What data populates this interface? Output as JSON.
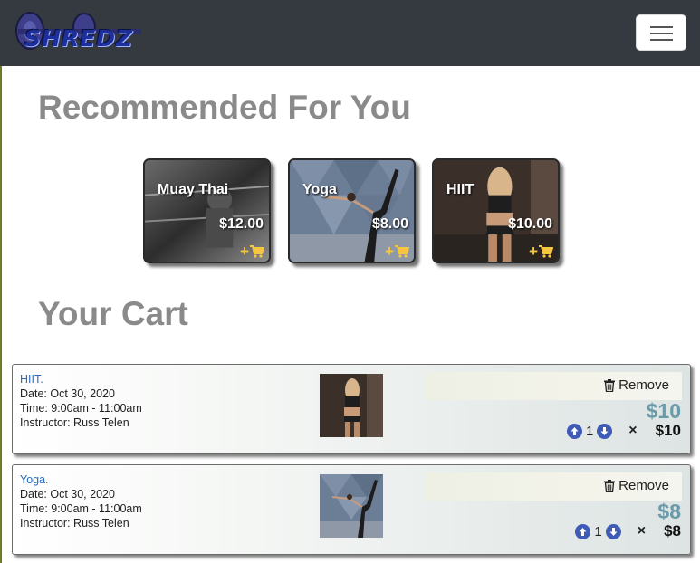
{
  "brand": {
    "logo_text": "SHREDZ"
  },
  "sections": {
    "recommended_title": "Recommended For You",
    "cart_title": "Your Cart"
  },
  "recommended": [
    {
      "name": "Muay Thai",
      "price": "$12.00"
    },
    {
      "name": "Yoga",
      "price": "$8.00"
    },
    {
      "name": "HIIT",
      "price": "$10.00"
    }
  ],
  "cart": {
    "items": [
      {
        "title": "HIIT.",
        "date": "Date: Oct 30, 2020",
        "time": "Time: 9:00am - 11:00am",
        "instructor": "Instructor: Russ Telen",
        "remove_label": "Remove",
        "price": "$10",
        "quantity": "1",
        "multiply": "×",
        "line_total": "$10"
      },
      {
        "title": "Yoga.",
        "date": "Date: Oct 30, 2020",
        "time": "Time: 9:00am - 11:00am",
        "instructor": "Instructor: Russ Telen",
        "remove_label": "Remove",
        "price": "$8",
        "quantity": "1",
        "multiply": "×",
        "line_total": "$8"
      }
    ]
  },
  "icons": {
    "menu": "hamburger-icon",
    "add_to_cart": "cart-plus-icon",
    "remove": "trash-icon",
    "increase": "arrow-up-circle-icon",
    "decrease": "arrow-down-circle-icon"
  },
  "colors": {
    "navbar": "#343a40",
    "heading": "#8a8a8a",
    "accent_gold": "#f6c542",
    "item_title": "#2a6bbf",
    "price_teal": "#6b9aa8",
    "qty_button": "#3f5bb5"
  }
}
